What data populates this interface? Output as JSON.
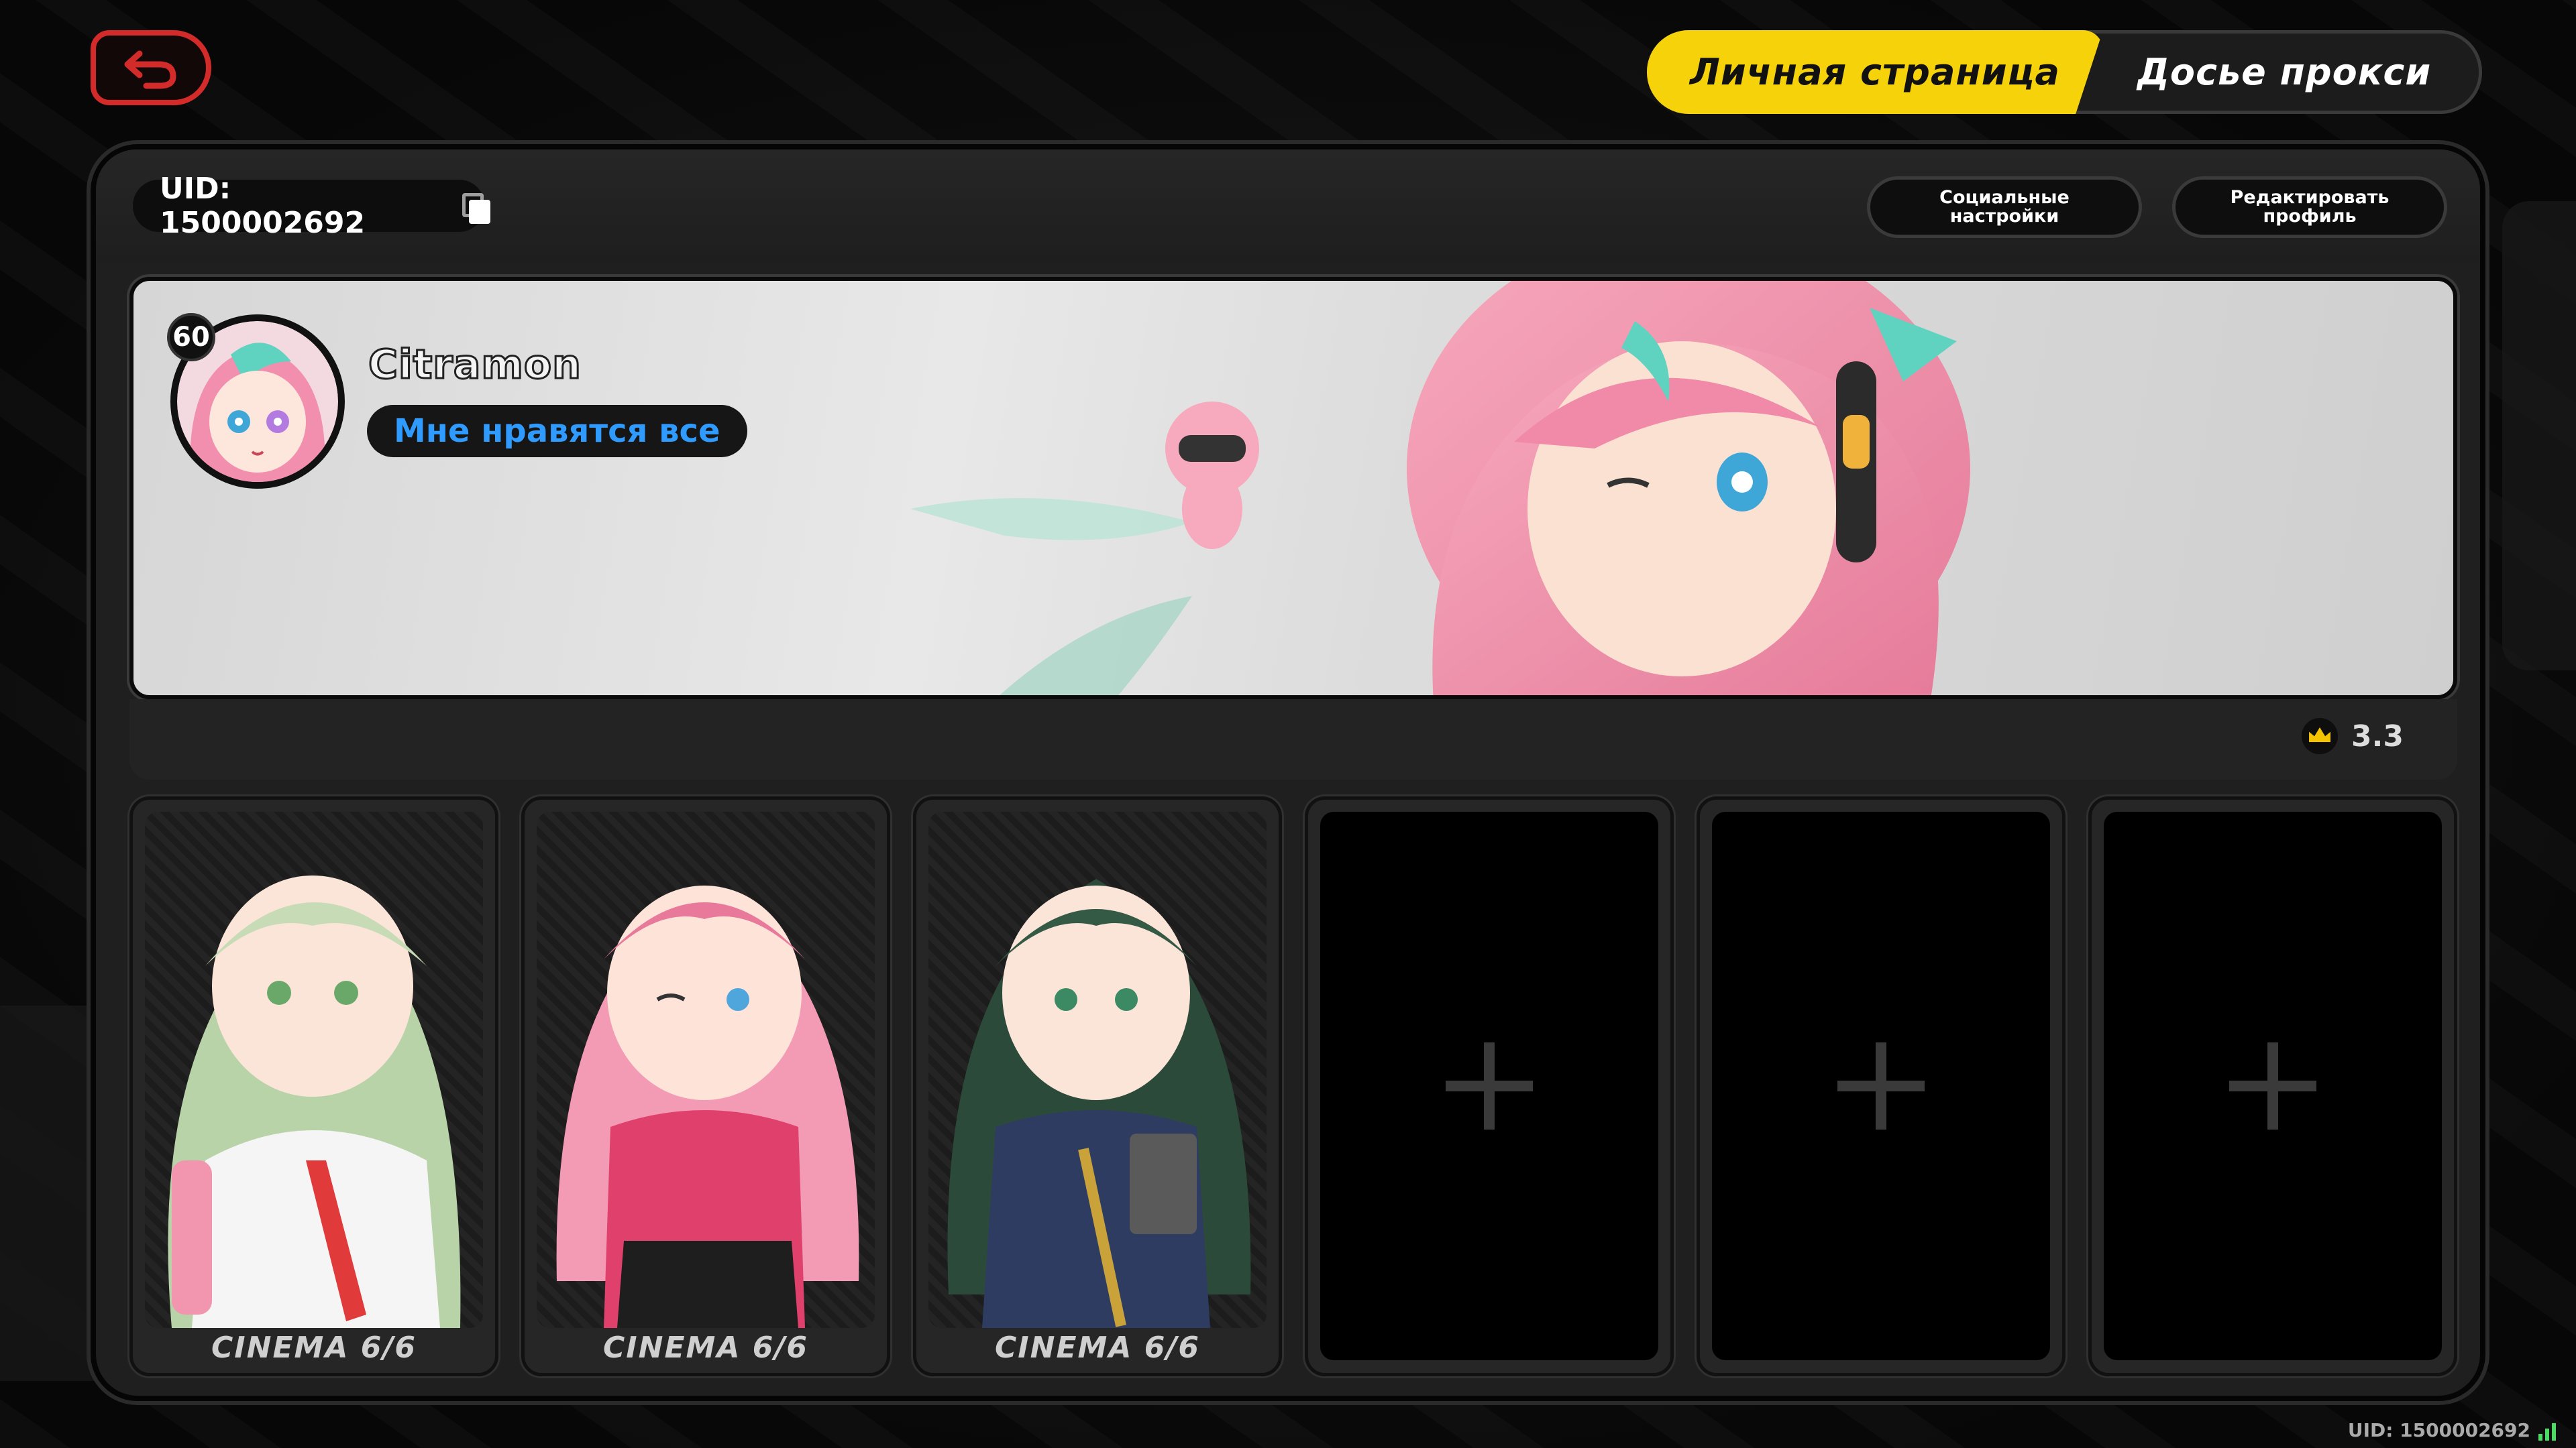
{
  "header": {
    "tabs": [
      {
        "label": "Личная страница",
        "active": true
      },
      {
        "label": "Досье прокси",
        "active": false
      }
    ]
  },
  "profile": {
    "uid_label": "UID: 1500002692",
    "buttons": {
      "social": "Социальные настройки",
      "edit": "Редактировать профиль"
    },
    "level": "60",
    "username": "Citramon",
    "status": "Мне нравятся все",
    "rating": "3.3"
  },
  "cards": [
    {
      "label": "CINEMA 6/6",
      "filled": true,
      "palette": "mint"
    },
    {
      "label": "CINEMA 6/6",
      "filled": true,
      "palette": "pink"
    },
    {
      "label": "CINEMA 6/6",
      "filled": true,
      "palette": "green"
    },
    {
      "label": "",
      "filled": false
    },
    {
      "label": "",
      "filled": false
    },
    {
      "label": "",
      "filled": false
    }
  ],
  "footer": {
    "uid": "UID: 1500002692"
  },
  "colors": {
    "accent": "#f5d20a",
    "status_text": "#2f9bff",
    "back_button": "#d32a2a"
  }
}
